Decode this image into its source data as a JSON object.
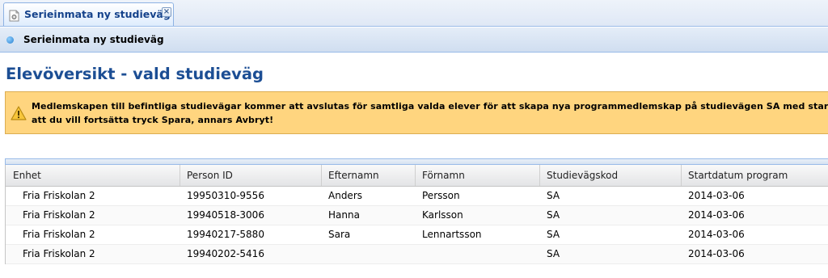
{
  "tabs": [
    {
      "label": "Serieinmata ny studieväg",
      "close_glyph": "×",
      "icon": "settings-page-icon"
    }
  ],
  "panel": {
    "title": "Serieinmata ny studieväg",
    "icon": "bullet-icon"
  },
  "page": {
    "title": "Elevöversikt - vald studieväg"
  },
  "warning": {
    "icon": "warning-icon",
    "line1": "Medlemskapen till befintliga studievägar kommer att avslutas för samtliga valda elever för att skapa nya programmedlemskap på studievägen SA med startdatum",
    "line2": "att du vill fortsätta tryck Spara, annars Avbryt!",
    "background": "#ffd57f"
  },
  "grid": {
    "columns": [
      "Enhet",
      "Person ID",
      "Efternamn",
      "Förnamn",
      "Studievägskod",
      "Startdatum program"
    ],
    "rows": [
      [
        "Fria Friskolan 2",
        "19950310-9556",
        "Anders",
        "Persson",
        "SA",
        "2014-03-06"
      ],
      [
        "Fria Friskolan 2",
        "19940518-3006",
        "Hanna",
        "Karlsson",
        "SA",
        "2014-03-06"
      ],
      [
        "Fria Friskolan 2",
        "19940217-5880",
        "Sara",
        "Lennartsson",
        "SA",
        "2014-03-06"
      ],
      [
        "Fria Friskolan 2",
        "19940202-5416",
        "",
        "",
        "SA",
        "2014-03-06"
      ]
    ]
  },
  "colors": {
    "accent": "#15428b",
    "title": "#1c4e94",
    "header_border": "#99bbe8"
  }
}
